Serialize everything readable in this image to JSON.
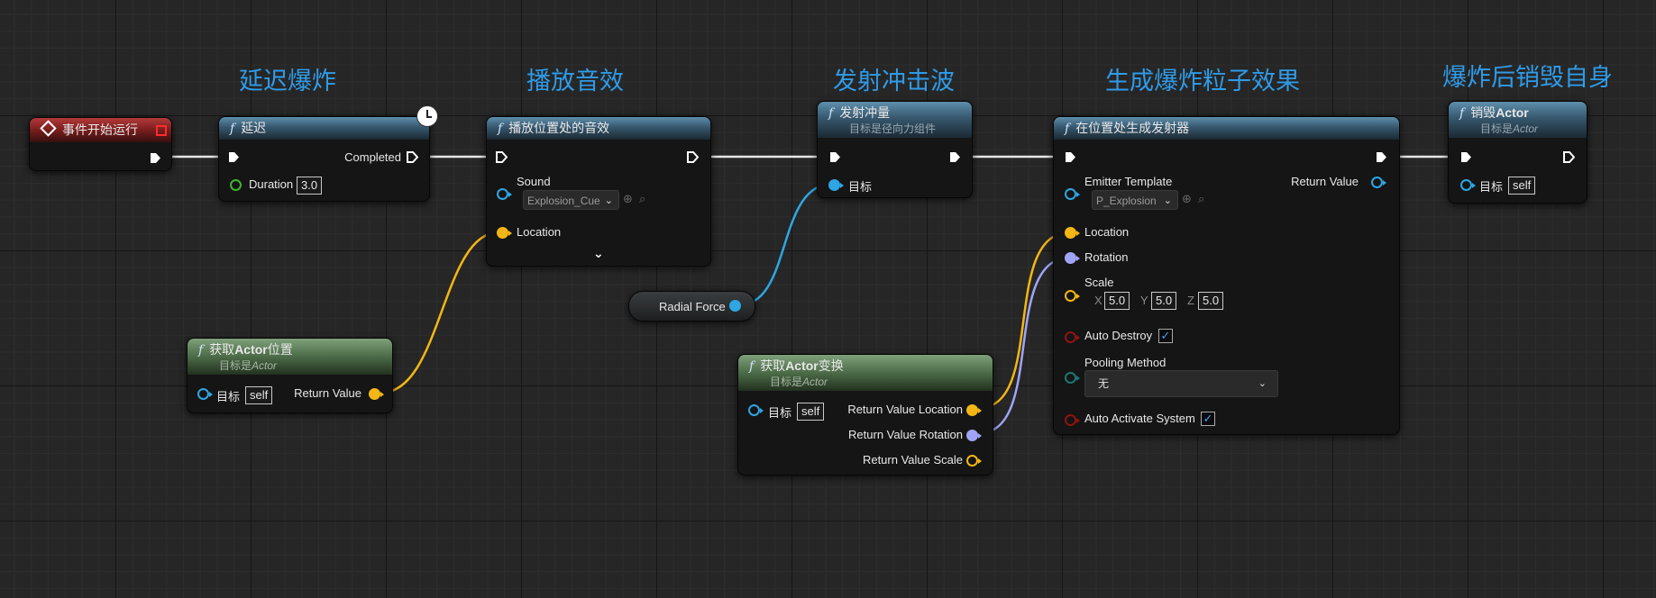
{
  "comments": {
    "delay": "延迟爆炸",
    "sound": "播放音效",
    "shockwave": "发射冲击波",
    "particles": "生成爆炸粒子效果",
    "destroy": "爆炸后销毁自身"
  },
  "event_node": {
    "title": "事件开始运行"
  },
  "delay_node": {
    "title": "延迟",
    "completed": "Completed",
    "duration_label": "Duration",
    "duration_value": "3.0"
  },
  "sound_node": {
    "title": "播放位置处的音效",
    "sound_label": "Sound",
    "sound_value": "Explosion_Cue",
    "location_label": "Location"
  },
  "impulse_node": {
    "title": "发射冲量",
    "subtitle": "目标是径向力组件",
    "target_label": "目标"
  },
  "radial_force": {
    "label": "Radial Force"
  },
  "get_loc_node": {
    "title_pre": "获取",
    "title_bold": "Actor",
    "title_post": "位置",
    "subtitle_pre": "目标是",
    "subtitle_it": "Actor",
    "target_label": "目标",
    "self": "self",
    "return": "Return Value"
  },
  "get_xf_node": {
    "title_pre": "获取",
    "title_bold": "Actor",
    "title_post": "变换",
    "subtitle_pre": "目标是",
    "subtitle_it": "Actor",
    "target_label": "目标",
    "self": "self",
    "ret_loc": "Return Value Location",
    "ret_rot": "Return Value Rotation",
    "ret_scale": "Return Value Scale"
  },
  "emitter_node": {
    "title": "在位置处生成发射器",
    "template_label": "Emitter Template",
    "template_value": "P_Explosion",
    "return": "Return Value",
    "location": "Location",
    "rotation": "Rotation",
    "scale": "Scale",
    "x_label": "X",
    "x": "5.0",
    "y_label": "Y",
    "y": "5.0",
    "z_label": "Z",
    "z": "5.0",
    "auto_destroy": "Auto Destroy",
    "pooling": "Pooling Method",
    "pooling_value": "无",
    "auto_activate": "Auto Activate System"
  },
  "destroy_node": {
    "title_pre": "销毁",
    "title_bold": "Actor",
    "subtitle_pre": "目标是",
    "subtitle_it": "Actor",
    "target_label": "目标",
    "self": "self"
  },
  "colors": {
    "exec": "#ffffff",
    "object": "#2ea6e3",
    "vector": "#f3b614",
    "rotator": "#a0a4f5",
    "float": "#3fb52c",
    "bool": "#8f1313",
    "byte": "#1d7573",
    "comment": "#2f9be8"
  }
}
